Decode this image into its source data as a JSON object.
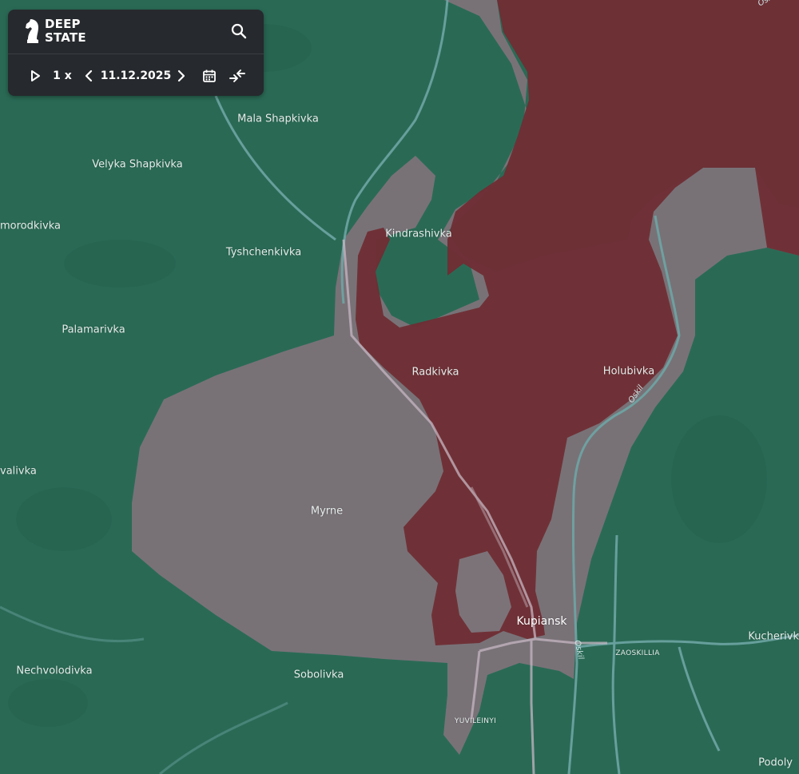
{
  "app": {
    "logo_line1": "DEEP",
    "logo_line2": "STATE",
    "logo_icon": "chess-knight-icon",
    "search_icon": "search-icon"
  },
  "timeline": {
    "play_icon": "play-icon",
    "speed": "1 x",
    "prev_icon": "chevron-left-icon",
    "date": "11.12.2025",
    "next_icon": "chevron-right-icon",
    "calendar_icon": "calendar-icon",
    "compare_icon": "compare-arrows-icon"
  },
  "map": {
    "colors": {
      "ukraine_controlled": "#2a6a55",
      "contested_gray_zone": "#7c7379",
      "russian_occupied": "#6e2e35",
      "river": "#6fa5a5",
      "road": "#c7b7c3"
    },
    "places": [
      {
        "id": "mala-shapkivka",
        "name": "Mala Shapkivka"
      },
      {
        "id": "velyka-shapkivka",
        "name": "Velyka Shapkivka"
      },
      {
        "id": "smorodkivka",
        "name": "morodkivka"
      },
      {
        "id": "tyshchenkivka",
        "name": "Tyshchenkivka"
      },
      {
        "id": "kindrashivka",
        "name": "Kindrashivka"
      },
      {
        "id": "palamarivka",
        "name": "Palamarivka"
      },
      {
        "id": "radkivka",
        "name": "Radkivka"
      },
      {
        "id": "holubivka",
        "name": "Holubivka"
      },
      {
        "id": "kovalivka",
        "name": "valivka"
      },
      {
        "id": "myrne",
        "name": "Myrne"
      },
      {
        "id": "kupiansk",
        "name": "Kupiansk"
      },
      {
        "id": "kucherivka",
        "name": "Kucherivk"
      },
      {
        "id": "zaoskillia",
        "name": "ZAOSKILLIA"
      },
      {
        "id": "nechvolodivka",
        "name": "Nechvolodivka"
      },
      {
        "id": "sobolivka",
        "name": "Sobolivka"
      },
      {
        "id": "yuvileinyi",
        "name": "YUVILEINYI"
      },
      {
        "id": "podoly",
        "name": "Podoly"
      }
    ],
    "river_labels": [
      {
        "id": "oskil-top",
        "name": "Oskil"
      },
      {
        "id": "oskil-mid",
        "name": "Oskil"
      },
      {
        "id": "oskil-low",
        "name": "Oskil"
      }
    ]
  }
}
